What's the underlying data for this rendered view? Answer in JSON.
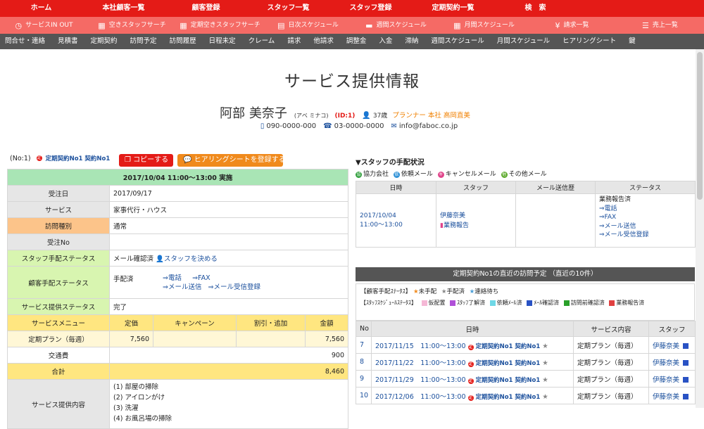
{
  "nav1": [
    "ホーム",
    "本社顧客一覧",
    "顧客登録",
    "スタッフ一覧",
    "スタッフ登録",
    "定期契約一覧",
    "検　索"
  ],
  "nav2": [
    {
      "icon": "clock-icon",
      "glyph": "◷",
      "label": "サービスIN OUT"
    },
    {
      "icon": "calendar-icon",
      "glyph": "▦",
      "label": "空きスタッフサーチ"
    },
    {
      "icon": "calendar-icon",
      "glyph": "▦",
      "label": "定期空きスタッフサーチ"
    },
    {
      "icon": "calendar-icon",
      "glyph": "▤",
      "label": "日次スケジュール"
    },
    {
      "icon": "calendar-icon",
      "glyph": "▬",
      "label": "週間スケジュール"
    },
    {
      "icon": "calendar-icon",
      "glyph": "▦",
      "label": "月間スケジュール"
    },
    {
      "icon": "yen-icon",
      "glyph": "¥",
      "label": "請求一覧"
    },
    {
      "icon": "list-icon",
      "glyph": "☰",
      "label": "売上一覧"
    }
  ],
  "nav3": [
    "問合せ・連絡",
    "見積書",
    "定期契約",
    "訪問予定",
    "訪問履歴",
    "日程未定",
    "クレーム",
    "請求",
    "他請求",
    "調整金",
    "入金",
    "滞納",
    "週間スケジュール",
    "月間スケジュール",
    "ヒアリングシート",
    "鍵"
  ],
  "page_title": "サービス提供情報",
  "customer": {
    "name": "阿部 美奈子",
    "kana": "(アベ ミナコ)",
    "id": "(ID:1)",
    "age": "37歳",
    "planner": "プランナー 本社 高岡直美",
    "mobile": "090-0000-000",
    "phone": "03-0000-0000",
    "email": "info@faboc.co.jp"
  },
  "left": {
    "no": "(No:1)",
    "contract_tag": "定期契約No1 契約No1",
    "copy_btn": "コピーする",
    "hearing_btn": "ヒアリングシートを登録する",
    "date_header": "2017/10/04 11:00～13:00 実施",
    "rows": {
      "order_date_label": "受注日",
      "order_date": "2017/09/17",
      "service_label": "サービス",
      "service": "家事代行・ハウス",
      "visit_type_label": "訪問種別",
      "visit_type": "通常",
      "order_no_label": "受注No",
      "order_no": "",
      "staff_status_label": "スタッフ手配ステータス",
      "staff_status": "メール確認済",
      "staff_decide": "スタッフを決める",
      "cust_status_label": "顧客手配ステータス",
      "cust_status": "手配済",
      "link_tel": "⇒電話",
      "link_fax": "⇒FAX",
      "link_mail": "⇒メール送信",
      "link_mail_recv": "⇒メール受信登録",
      "provide_status_label": "サービス提供ステータス",
      "provide_status": "完了"
    },
    "menu": {
      "headers": [
        "サービスメニュー",
        "定価",
        "キャンペーン",
        "割引・追加",
        "金額"
      ],
      "plan_name": "定期プラン（毎週）",
      "plan_price": "7,560",
      "plan_amount": "7,560",
      "transport_label": "交通費",
      "transport": "900",
      "total_label": "合計",
      "total": "8,460"
    },
    "content_label": "サービス提供内容",
    "content_items": [
      "(1) 部屋の掃除",
      "(2) アイロンがけ",
      "(3) 洗濯",
      "(4) お風呂場の掃除"
    ]
  },
  "right": {
    "staff_title": "▼スタッフの手配状況",
    "legend": [
      {
        "label": "協力会社",
        "color": "#2e9e3a",
        "mark": "協"
      },
      {
        "label": "依頼メール",
        "color": "#2a8fd6",
        "mark": "依"
      },
      {
        "label": "キャンセルメール",
        "color": "#e0458b",
        "mark": "キ"
      },
      {
        "label": "その他メール",
        "color": "#5aa829",
        "mark": "他"
      }
    ],
    "staff_headers": [
      "日時",
      "スタッフ",
      "メール送信歴",
      "ステータス"
    ],
    "staff_row": {
      "date": "2017/10/04",
      "time": "11:00～13:00",
      "staff": "伊藤奈美",
      "report": "業務報告",
      "status": "業務報告済",
      "links": [
        "⇒電話",
        "⇒FAX",
        "⇒メール送信",
        "⇒メール受信登録"
      ]
    },
    "visit_title": "定期契約No1の直近の訪問予定 （直近の10件）",
    "cust_legend_label": "【顧客手配ｽﾃｰﾀｽ】",
    "cust_legend": [
      {
        "label": "未手配",
        "color": "#f08a1c"
      },
      {
        "label": "手配済",
        "color": "#888888"
      },
      {
        "label": "連絡待ち",
        "color": "#4a9fd8"
      }
    ],
    "staff_legend_label": "【ｽﾀｯﾌｽｹｼﾞｭｰﾙｽﾃｰﾀｽ】",
    "staff_legend": [
      {
        "label": "仮配置",
        "color": "#f5b8d6"
      },
      {
        "label": "ｽﾀｯﾌ了解済",
        "color": "#b050d8"
      },
      {
        "label": "依頼ﾒｰﾙ済",
        "color": "#6fd8e6"
      },
      {
        "label": "ﾒｰﾙ確認済",
        "color": "#2952c4"
      },
      {
        "label": "訪問前確認済",
        "color": "#2aa02a"
      },
      {
        "label": "業務報告済",
        "color": "#e04040"
      }
    ],
    "visit_headers": [
      "No",
      "日時",
      "サービス内容",
      "スタッフ"
    ],
    "visits": [
      {
        "no": "7",
        "date": "2017/11/15　11:00～13:00",
        "tag": "定期契約No1 契約No1",
        "service": "定期プラン（毎週）",
        "staff": "伊藤奈美"
      },
      {
        "no": "8",
        "date": "2017/11/22　11:00～13:00",
        "tag": "定期契約No1 契約No1",
        "service": "定期プラン（毎週）",
        "staff": "伊藤奈美"
      },
      {
        "no": "9",
        "date": "2017/11/29　11:00～13:00",
        "tag": "定期契約No1 契約No1",
        "service": "定期プラン（毎週）",
        "staff": "伊藤奈美"
      },
      {
        "no": "10",
        "date": "2017/12/06　11:00～13:00",
        "tag": "定期契約No1 契約No1",
        "service": "定期プラン（毎週）",
        "staff": "伊藤奈美"
      }
    ]
  }
}
